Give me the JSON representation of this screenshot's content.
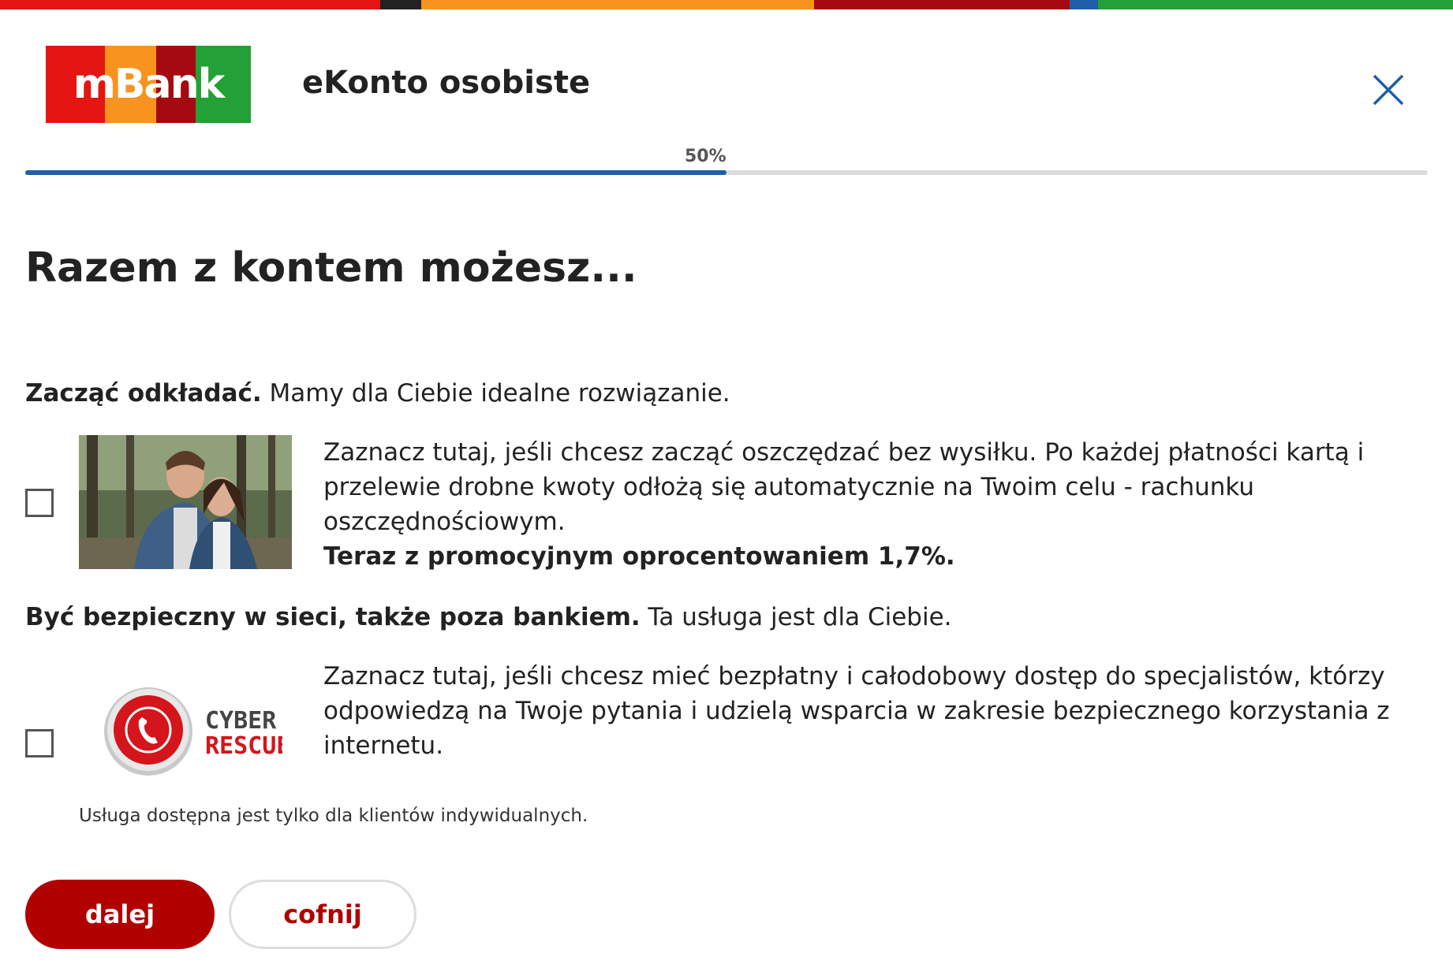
{
  "brand": {
    "logo_text": "mBank",
    "stripe_colors": [
      "#e41513",
      "#222222",
      "#f7931e",
      "#a40a10",
      "#1f5ea8",
      "#23a036"
    ],
    "logo_colors": [
      "#e41513",
      "#f7931e",
      "#a40a10",
      "#23a036"
    ]
  },
  "header": {
    "product_title": "eKonto osobiste",
    "close_icon": "close-icon"
  },
  "progress": {
    "label": "50%",
    "value": 0.5,
    "fill_color": "#1f5ea8"
  },
  "main": {
    "title": "Razem z kontem możesz...",
    "sections": [
      {
        "heading_bold": "Zacząć odkładać.",
        "heading_rest": " Mamy dla Ciebie idealne rozwiązanie.",
        "description": "Zaznacz tutaj, jeśli chcesz zacząć oszczędzać bez wysiłku. Po każdej płatności kartą i przelewie drobne kwoty odłożą się automatycznie na Twoim celu - rachunku oszczędnościowym.",
        "promo": "Teraz z promocyjnym oprocentowaniem 1,7%.",
        "image": "couple-photo",
        "checked": false
      },
      {
        "heading_bold": "Być bezpieczny w sieci, także poza bankiem.",
        "heading_rest": " Ta usługa jest dla Ciebie.",
        "description": "Zaznacz tutaj, jeśli chcesz mieć bezpłatny i całodobowy dostęp do specjalistów, którzy odpowiedzą na Twoje pytania i udzielą wsparcia w zakresie bezpiecznego korzystania z internetu.",
        "logo_line1": "CYBER",
        "logo_line2": "RESCUE",
        "image": "cyber-rescue-logo",
        "checked": false
      }
    ],
    "note": "Usługa dostępna jest tylko dla klientów indywidualnych."
  },
  "buttons": {
    "next_label": "dalej",
    "back_label": "cofnij",
    "accent": "#b20000"
  }
}
